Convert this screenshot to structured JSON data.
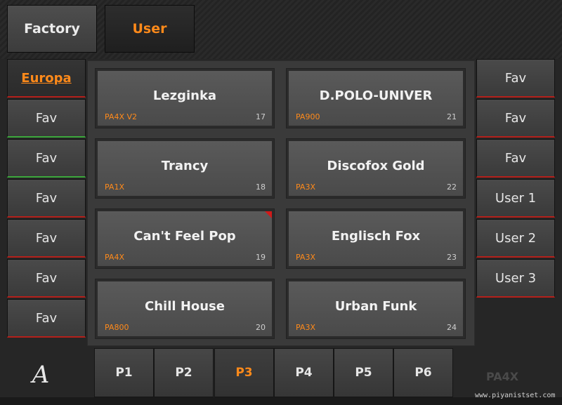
{
  "top_tabs": {
    "factory": "Factory",
    "user": "User"
  },
  "left_buttons": [
    {
      "label": "Europa",
      "active": true
    },
    {
      "label": "Fav"
    },
    {
      "label": "Fav"
    },
    {
      "label": "Fav"
    },
    {
      "label": "Fav"
    },
    {
      "label": "Fav"
    },
    {
      "label": "Fav"
    }
  ],
  "right_buttons": [
    {
      "label": "Fav"
    },
    {
      "label": "Fav"
    },
    {
      "label": "Fav"
    },
    {
      "label": "User 1"
    },
    {
      "label": "User 2"
    },
    {
      "label": "User 3"
    }
  ],
  "styles": [
    {
      "name": "Lezginka",
      "model": "PA4X V2",
      "number": "17"
    },
    {
      "name": "D.POLO-UNIVER",
      "model": "PA900",
      "number": "21"
    },
    {
      "name": "Trancy",
      "model": "PA1X",
      "number": "18"
    },
    {
      "name": "Discofox Gold",
      "model": "PA3X",
      "number": "22"
    },
    {
      "name": "Can't Feel Pop",
      "model": "PA4X",
      "number": "19"
    },
    {
      "name": "Englisch Fox",
      "model": "PA3X",
      "number": "23"
    },
    {
      "name": "Chill House",
      "model": "PA800",
      "number": "20"
    },
    {
      "name": "Urban Funk",
      "model": "PA3X",
      "number": "24"
    }
  ],
  "pages": [
    "P1",
    "P2",
    "P3",
    "P4",
    "P5",
    "P6"
  ],
  "active_page": "P3",
  "brand": "PA4X",
  "watermark": "www.piyanistset.com",
  "logo_glyph": "A",
  "colors": {
    "accent": "#ff8a1a",
    "fav_indicator_red": "#b5201b",
    "fav_indicator_green": "#3ca83c"
  }
}
